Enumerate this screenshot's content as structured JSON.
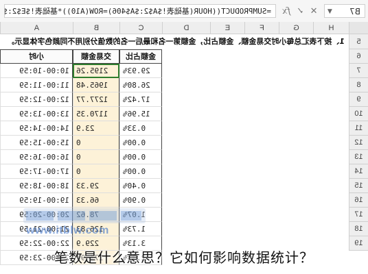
{
  "formula_bar": {
    "name_box": "B7",
    "formula": "=SUMPRODUCT((HOUR(基础表!$A$2:$A$406)=ROW(A10))*基础表!$E$2:$E$406)"
  },
  "columns": [
    "H",
    "G",
    "F",
    "E",
    "D",
    "C",
    "B",
    "A"
  ],
  "row_numbers": [
    "5",
    "6",
    "7",
    "8",
    "9",
    "10",
    "11",
    "12",
    "13",
    "14",
    "15",
    "16",
    "17",
    "18",
    "19"
  ],
  "note": "1、按下表汇总每小时交易金额、金额占比，金额第一名和最后一名的数值分别用不同颜色字体显示。",
  "table": {
    "headers": [
      "小时",
      "交易金额",
      "金额占比"
    ],
    "rows": [
      [
        "10:00-10:59",
        "2195.26",
        "29.93%"
      ],
      [
        "11:00-11:59",
        "1965.48",
        "26.80%"
      ],
      [
        "12:00-12:59",
        "1277.77",
        "17.42%"
      ],
      [
        "13:00-13:59",
        "1170.35",
        "15.96%"
      ],
      [
        "14:00-14:59",
        "23.9",
        "0.33%"
      ],
      [
        "15:00-15:59",
        "0",
        "0.00%"
      ],
      [
        "16:00-16:59",
        "0",
        "0.00%"
      ],
      [
        "17:00-17:59",
        "0",
        "0.00%"
      ],
      [
        "18:00-18:59",
        "29.33",
        "0.40%"
      ],
      [
        "19:00-19:59",
        "66.33",
        "0.90%"
      ],
      [
        "20:00-20:59",
        "78.62",
        "1.07%"
      ],
      [
        "21:00-21:59",
        "126.83",
        "1.73%"
      ],
      [
        "22:00-22:59",
        "229.9",
        "3.13%"
      ],
      [
        "23:00-23:59",
        "171.95",
        "2.33%"
      ]
    ]
  },
  "watermark": {
    "text_cn": "部落窝原创教程",
    "url": "www.itblw.com"
  },
  "caption": "笔数是什么意思？它如何影响数据统计？",
  "colors": {
    "amount_fill": "#fdf2d8",
    "selection": "#2d7d2d",
    "header_bg": "#eeeeee"
  }
}
